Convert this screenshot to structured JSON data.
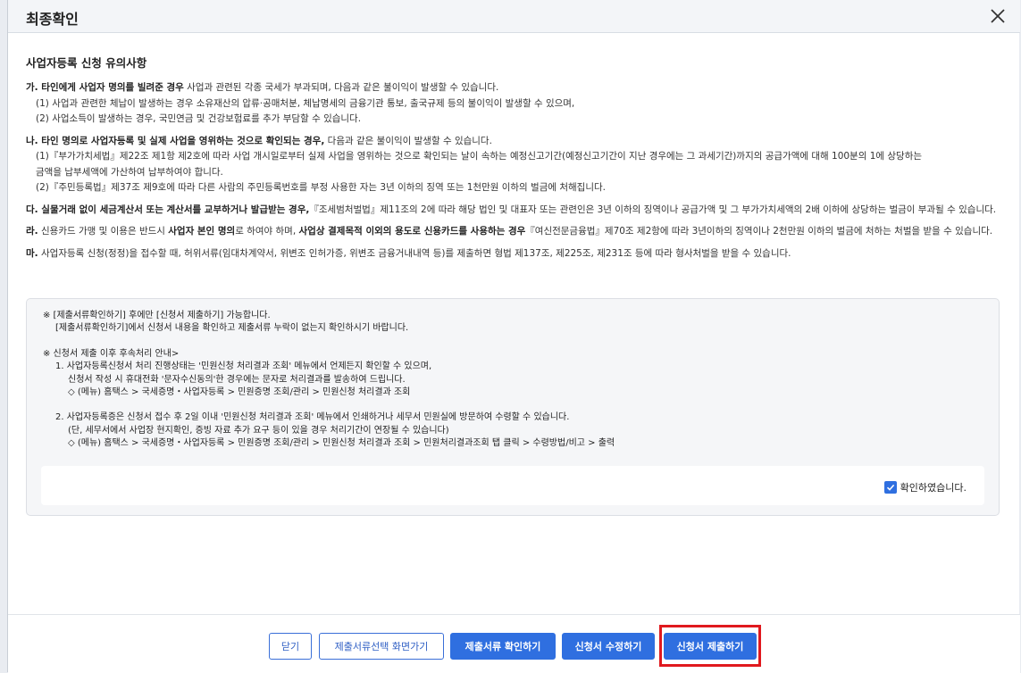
{
  "modal": {
    "title": "최종확인"
  },
  "section": {
    "title": "사업자등록 신청 유의사항",
    "items": {
      "ga": {
        "bold": "가. 타인에게 사업자 명의를 빌려준 경우",
        "text": " 사업과 관련된 각종 국세가 부과되며, 다음과 같은 불이익이 발생할 수 있습니다.",
        "sub1": "(1) 사업과 관련한 체납이 발생하는 경우 소유재산의 압류·공매처분, 체납명세의 금융기관 통보, 출국규제 등의 불이익이 발생할 수 있으며,",
        "sub2": "(2) 사업소득이 발생하는 경우, 국민연금 및 건강보험료를 추가 부담할 수 있습니다."
      },
      "na": {
        "bold": "나. 타인 명의로 사업자등록 및 실제 사업을 영위하는 것으로 확인되는 경우,",
        "text": " 다음과 같은 불이익이 발생할 수 있습니다.",
        "sub1a": "(1)『부가가치세법』제22조 제1항 제2호에 따라 사업 개시일로부터 실제 사업을 영위하는 것으로 확인되는 날이 속하는 예정신고기간(예정신고기간이 지난 경우에는 그 과세기간)까지의 공급가액에 대해 100분의 1에 상당하는",
        "sub1b": "금액을 납부세액에 가산하여 납부하여야 합니다.",
        "sub2": "(2)『주민등록법』제37조 제9호에 따라 다른 사람의 주민등록번호를 부정 사용한 자는 3년 이하의 징역 또는 1천만원 이하의 벌금에 처해집니다."
      },
      "da": {
        "bold": "다. 실물거래 없이 세금계산서 또는 계산서를 교부하거나 발급받는 경우,",
        "text": "『조세범처벌법』제11조의 2에 따라 해당 법인 및 대표자 또는 관련인은 3년 이하의 징역이나 공급가액 및 그 부가가치세액의 2배 이하에 상당하는 벌금이 부과될 수 있습니다."
      },
      "ra": {
        "prefix": "라.",
        "text1": " 신용카드 가맹 및 이용은 반드시 ",
        "bold1": "사업자 본인 명의",
        "text2": "로 하여야 하며, ",
        "bold2": "사업상 결제목적 이외의 용도로 신용카드를 사용하는 경우",
        "text3": "『여신전문금융법』제70조 제2항에 따라 3년이하의 징역이나 2천만원 이하의 벌금에 처하는 처벌을 받을 수 있습니다."
      },
      "ma": {
        "prefix": "마.",
        "text": " 사업자등록 신청(정정)을 접수할 때, 허위서류(임대차계약서, 위변조 인허가증, 위변조 금융거내내역 등)를 제출하면 형법 제137조, 제225조, 제231조 등에 따라 형사처벌을 받을 수 있습니다."
      }
    }
  },
  "notice": {
    "line1": "※ [제출서류확인하기] 후에만 [신청서 제출하기] 가능합니다.",
    "line2": "[제출서류확인하기]에서 신청서 내용을 확인하고 제출서류 누락이 없는지 확인하시기 바랍니다.",
    "line3": "※ 신청서 제출 이후 후속처리 안내>",
    "item1a": "1.  사업자등록신청서 처리 진행상태는 '민원신청 처리결과 조회' 메뉴에서 언제든지 확인할 수 있으며,",
    "item1b": "신청서 작성 시 휴대전화 '문자수신동의'한 경우에는 문자로 처리결과를 발송하여 드립니다.",
    "item1c": "◇ (메뉴) 홈택스 > 국세증명・사업자등록 > 민원증명 조회/관리 > 민원신청 처리결과 조회",
    "item2a": "2.  사업자등록증은 신청서 접수 후 2일 이내 '민원신청 처리결과 조회' 메뉴에서 인쇄하거나 세무서 민원실에 방문하여 수령할 수 있습니다.",
    "item2b": "(단, 세무서에서 사업장 현지확인, 증빙 자료 추가 요구 등이 있을 경우 처리기간이 연장될 수 있습니다)",
    "item2c": "◇ (메뉴) 홈택스 > 국세증명・사업자등록 > 민원증명 조회/관리 > 민원신청 처리결과 조회 > 민원처리결과조회 탭 클릭 > 수령방법/비고 > 출력",
    "confirm_label": "확인하였습니다.",
    "confirm_checked": true
  },
  "footer": {
    "close_label": "닫기",
    "select_docs_label": "제출서류선택 화면가기",
    "check_docs_label": "제출서류 확인하기",
    "edit_label": "신청서 수정하기",
    "submit_label": "신청서 제출하기"
  },
  "colors": {
    "accent": "#2f6fe0",
    "highlight": "#e0191e"
  }
}
